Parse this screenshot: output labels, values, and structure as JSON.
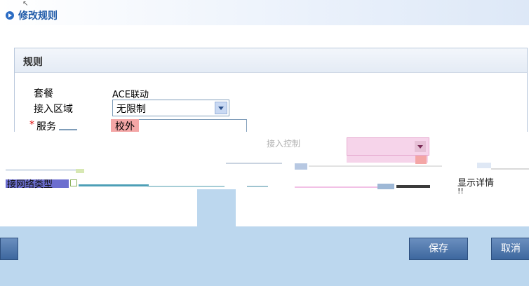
{
  "header": {
    "title": "修改规则",
    "cursor": "↖"
  },
  "panel": {
    "title": "规则"
  },
  "form": {
    "package_label": "套餐",
    "package_value": "ACE联动",
    "zone_label": "接入区域",
    "zone_value": "无限制",
    "service_label": "服务",
    "service_required_mark": "*",
    "service_value": "校外"
  },
  "fragments": {
    "access_control_fragment": "接入控制",
    "network_fragment": "接网络类型",
    "display_fragment": "显示详情",
    "display_fragment_tail": "!!"
  },
  "footer": {
    "left_button": "",
    "save_label": "保存",
    "cancel_label": "取消"
  },
  "colors": {
    "accent": "#1f5aa8",
    "footer_bg": "#bcd7ee",
    "chip_bg": "#f4a6a6"
  }
}
